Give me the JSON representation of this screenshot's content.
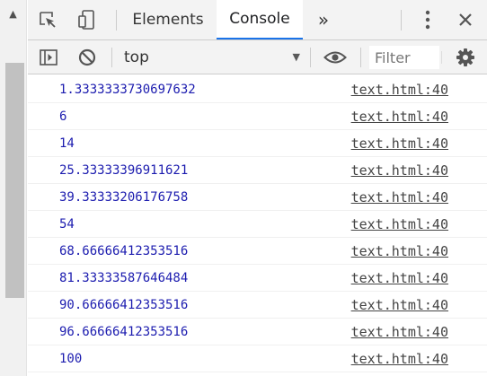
{
  "tabs": {
    "elements_label": "Elements",
    "console_label": "Console",
    "more_label": "»"
  },
  "toolbar": {
    "context_value": "top",
    "filter_placeholder": "Filter"
  },
  "icons": {
    "scroll_up": "triangle-up-icon",
    "inspect": "inspect-element-icon",
    "device": "device-toolbar-icon",
    "more_tabs": "double-chevron-icon",
    "menu": "kebab-menu-icon",
    "close": "close-icon",
    "sidebar": "sidebar-toggle-icon",
    "clear": "clear-console-icon",
    "dropdown": "dropdown-arrow-icon",
    "eye": "live-expression-eye-icon",
    "settings": "gear-icon"
  },
  "console": {
    "messages": [
      {
        "value": "1.3333333730697632",
        "source": "text.html:40"
      },
      {
        "value": "6",
        "source": "text.html:40"
      },
      {
        "value": "14",
        "source": "text.html:40"
      },
      {
        "value": "25.33333396911621",
        "source": "text.html:40"
      },
      {
        "value": "39.33333206176758",
        "source": "text.html:40"
      },
      {
        "value": "54",
        "source": "text.html:40"
      },
      {
        "value": "68.66666412353516",
        "source": "text.html:40"
      },
      {
        "value": "81.33333587646484",
        "source": "text.html:40"
      },
      {
        "value": "90.66666412353516",
        "source": "text.html:40"
      },
      {
        "value": "96.66666412353516",
        "source": "text.html:40"
      },
      {
        "value": "100",
        "source": "text.html:40"
      }
    ]
  },
  "colors": {
    "accent": "#1a73e8",
    "number_value": "#1c1caf",
    "toolbar_bg": "#f3f3f3"
  }
}
